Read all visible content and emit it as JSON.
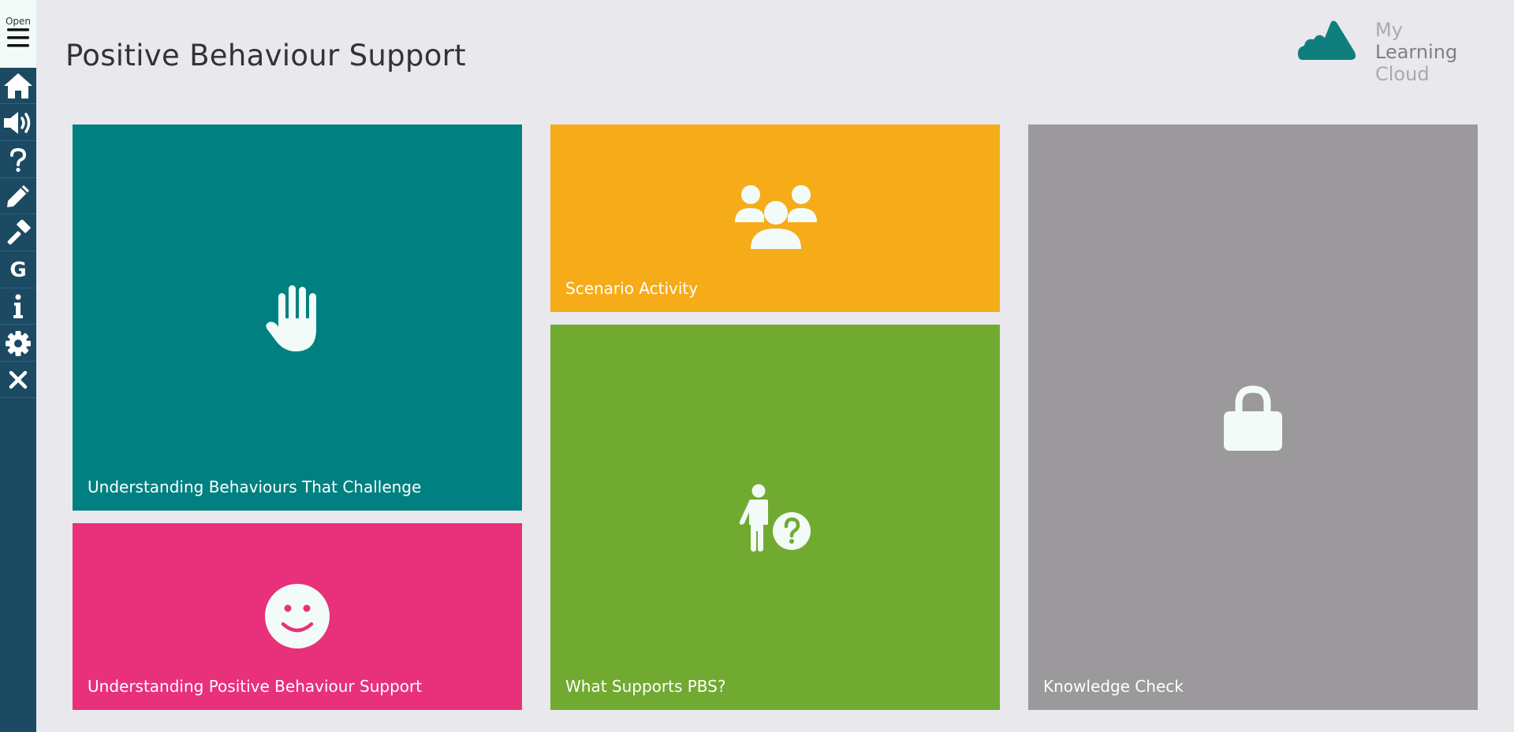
{
  "sidebar": {
    "open_label": "Open",
    "items": [
      {
        "icon": "home-icon"
      },
      {
        "icon": "audio-icon"
      },
      {
        "icon": "help-icon"
      },
      {
        "icon": "pencil-icon"
      },
      {
        "icon": "hammer-icon"
      },
      {
        "icon": "glossary-icon",
        "text": "G"
      },
      {
        "icon": "info-icon"
      },
      {
        "icon": "settings-icon"
      },
      {
        "icon": "close-icon"
      }
    ]
  },
  "header": {
    "title": "Positive Behaviour Support"
  },
  "logo": {
    "word1": "My",
    "word2": "Learning",
    "word3": "Cloud"
  },
  "tiles": [
    {
      "label": "Understanding Behaviours That Challenge",
      "icon": "hand-icon",
      "color": "#008080"
    },
    {
      "label": "Understanding Positive Behaviour Support",
      "icon": "smiley-icon",
      "color": "#e9307a"
    },
    {
      "label": "Scenario Activity",
      "icon": "group-icon",
      "color": "#f6ac19"
    },
    {
      "label": "What Supports PBS?",
      "icon": "person-question-icon",
      "color": "#71aa31"
    },
    {
      "label": "Knowledge Check",
      "icon": "lock-icon",
      "color": "#9b999b"
    }
  ],
  "colors": {
    "sidebar": "#1c4a62",
    "background": "#e9e8ed",
    "accent": "#008080"
  }
}
